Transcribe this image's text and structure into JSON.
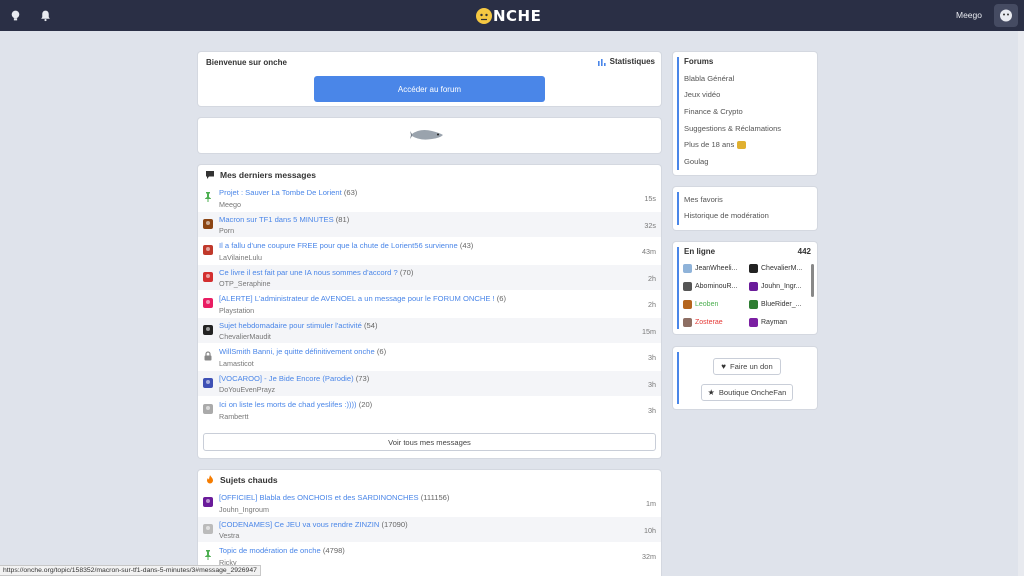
{
  "header": {
    "brand": "NCHE",
    "user": "Meego"
  },
  "welcome": {
    "title": "Bienvenue sur onche",
    "stats_label": "Statistiques",
    "cta": "Accéder au forum"
  },
  "messages": {
    "title": "Mes derniers messages",
    "rows": [
      {
        "title": "Projet : Sauver La Tombe De Lorient",
        "count": "(63)",
        "author": "Meego",
        "time": "15s",
        "icon": "pin-icon",
        "color": "#4caf50"
      },
      {
        "title": "Macron sur TF1 dans 5 MINUTES",
        "count": "(81)",
        "author": "Porn",
        "time": "32s",
        "icon": "avatar-icon",
        "color": "#8b4513"
      },
      {
        "title": "Il a fallu d'une coupure FREE pour que la chute de Lorient56 survienne",
        "count": "(43)",
        "author": "LaVilaineLulu",
        "time": "43m",
        "icon": "avatar-icon",
        "color": "#c0392b"
      },
      {
        "title": "Ce livre il est fait par une IA nous sommes d'accord ?",
        "count": "(70)",
        "author": "OTP_Seraphine",
        "time": "2h",
        "icon": "avatar-icon",
        "color": "#d32f2f"
      },
      {
        "title": "[ALERTE] L'administrateur de AVENOEL a un message pour le FORUM ONCHE !",
        "count": "(6)",
        "author": "Playstation",
        "time": "2h",
        "icon": "avatar-icon",
        "color": "#e91e63"
      },
      {
        "title": "Sujet hebdomadaire pour stimuler l'activité",
        "count": "(54)",
        "author": "ChevalierMaudit",
        "time": "15m",
        "icon": "avatar-icon",
        "color": "#222"
      },
      {
        "title": "WillSmith Banni, je quitte définitivement onche",
        "count": "(6)",
        "author": "Lamasticot",
        "time": "3h",
        "icon": "lock-icon",
        "color": "#888"
      },
      {
        "title": "[VOCAROO] - Je Bide Encore (Parodie)",
        "count": "(73)",
        "author": "DoYouEvenPrayz",
        "time": "3h",
        "icon": "avatar-icon",
        "color": "#3f51b5"
      },
      {
        "title": "Ici on liste les morts de chad yeslifes :))))",
        "count": "(20)",
        "author": "Rambertt",
        "time": "3h",
        "icon": "avatar-icon",
        "color": "#aaa"
      }
    ],
    "see_all": "Voir tous mes messages"
  },
  "hot": {
    "title": "Sujets chauds",
    "rows": [
      {
        "title": "[OFFICIEL] Blabla des ONCHOIS et des SARDINONCHES",
        "count": "(111156)",
        "author": "Jouhn_Ingroum",
        "time": "1m",
        "icon": "avatar-icon",
        "color": "#6a1b9a"
      },
      {
        "title": "[CODENAMES] Ce JEU va vous rendre ZINZIN",
        "count": "(17090)",
        "author": "Vestra",
        "time": "10h",
        "icon": "avatar-icon",
        "color": "#bbb"
      },
      {
        "title": "Topic de modération de onche",
        "count": "(4798)",
        "author": "Ricky",
        "time": "32m",
        "icon": "pin-icon",
        "color": "#4caf50"
      }
    ]
  },
  "forums": {
    "title": "Forums",
    "items": [
      "Blabla Général",
      "Jeux vidéo",
      "Finance & Crypto",
      "Suggestions & Réclamations",
      "Plus de 18 ans",
      "Goulag"
    ]
  },
  "links": {
    "items": [
      "Mes favoris",
      "Historique de modération"
    ]
  },
  "online": {
    "title": "En ligne",
    "count": "442",
    "users": [
      {
        "name": "JeanWheeli...",
        "color": "#333",
        "av": "#8fb3d9"
      },
      {
        "name": "ChevalierM...",
        "color": "#333",
        "av": "#222"
      },
      {
        "name": "AbominouR...",
        "color": "#333",
        "av": "#555"
      },
      {
        "name": "Jouhn_Ingr...",
        "color": "#333",
        "av": "#6a1b9a"
      },
      {
        "name": "Leoben",
        "color": "#4caf50",
        "av": "#b5651d"
      },
      {
        "name": "BlueRider_...",
        "color": "#333",
        "av": "#2e7d32"
      },
      {
        "name": "Zosterae",
        "color": "#e53935",
        "av": "#8d6e63"
      },
      {
        "name": "Rayman",
        "color": "#333",
        "av": "#7b1fa2"
      }
    ]
  },
  "support": {
    "donate": "Faire un don",
    "shop": "Boutique OncheFan"
  },
  "statusbar": {
    "url": "https://onche.org/topic/158352/macron-sur-tf1-dans-5-minutes/3#message_2926947"
  }
}
